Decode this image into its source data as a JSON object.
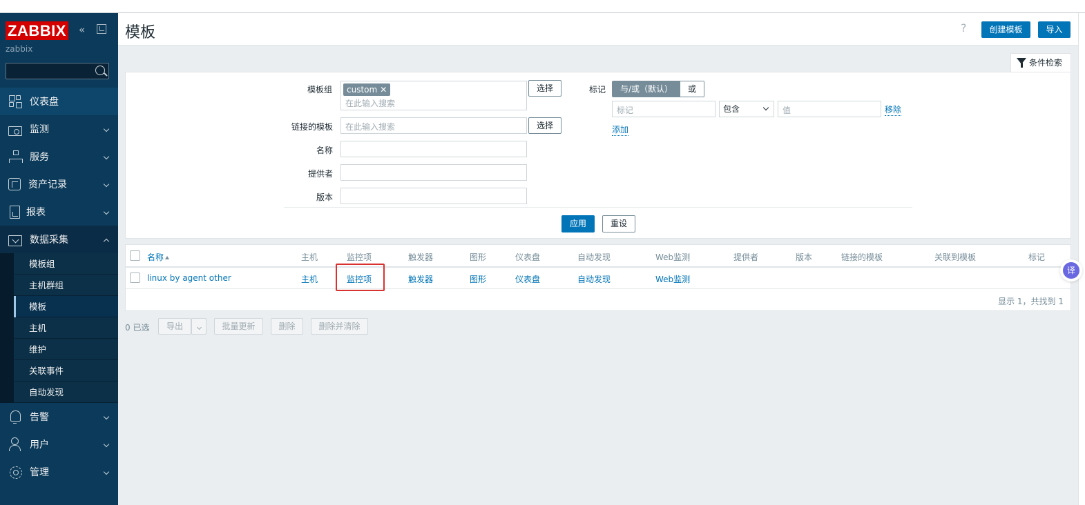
{
  "sidebar": {
    "logo": "ZABBIX",
    "server_name": "zabbix",
    "search_placeholder": "",
    "menu": [
      {
        "label": "仪表盘",
        "icon": "dashboard-icon"
      },
      {
        "label": "监测",
        "icon": "monitoring-icon"
      },
      {
        "label": "服务",
        "icon": "services-icon"
      },
      {
        "label": "资产记录",
        "icon": "inventory-icon"
      },
      {
        "label": "报表",
        "icon": "reports-icon"
      },
      {
        "label": "数据采集",
        "icon": "data-collection-icon"
      },
      {
        "label": "告警",
        "icon": "alerts-icon"
      },
      {
        "label": "用户",
        "icon": "users-icon"
      },
      {
        "label": "管理",
        "icon": "administration-icon"
      }
    ],
    "submenu": [
      "模板组",
      "主机群组",
      "模板",
      "主机",
      "维护",
      "关联事件",
      "自动发现"
    ]
  },
  "header": {
    "title": "模板",
    "help": "?",
    "create_button": "创建模板",
    "import_button": "导入"
  },
  "filter": {
    "tab_label": "条件检索",
    "template_group_label": "模板组",
    "template_group_chip": "custom",
    "chip_remove": "✕",
    "search_placeholder": "在此输入搜索",
    "select_button": "选择",
    "linked_templates_label": "链接的模板",
    "name_label": "名称",
    "vendor_label": "提供者",
    "version_label": "版本",
    "tags_label": "标记",
    "and_or": "与/或（默认）",
    "or": "或",
    "tag_placeholder": "标记",
    "operator": "包含",
    "value_placeholder": "值",
    "remove_link": "移除",
    "add_link": "添加",
    "apply_button": "应用",
    "reset_button": "重设"
  },
  "table": {
    "columns": [
      "名称",
      "主机",
      "监控项",
      "触发器",
      "图形",
      "仪表盘",
      "自动发现",
      "Web监测",
      "提供者",
      "版本",
      "链接的模板",
      "关联到模板",
      "标记"
    ],
    "rows": [
      {
        "name": "linux by agent other",
        "hosts": "主机",
        "items": "监控项",
        "triggers": "触发器",
        "graphs": "图形",
        "dashboards": "仪表盘",
        "discovery": "自动发现",
        "web": "Web监测"
      }
    ],
    "footer": "显示 1，共找到 1"
  },
  "actions": {
    "selected": "0 已选",
    "export": "导出",
    "mass_update": "批量更新",
    "delete": "删除",
    "delete_clear": "删除并清除"
  },
  "translate_bubble": "译"
}
